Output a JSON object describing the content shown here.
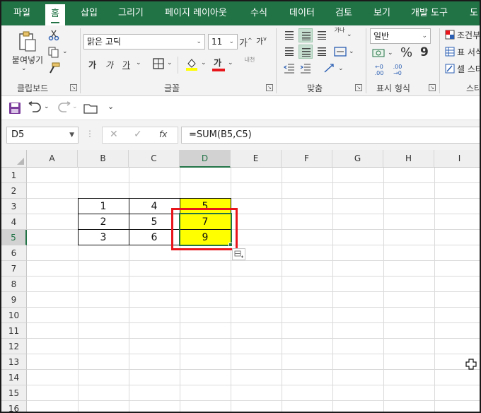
{
  "tabs": [
    "파일",
    "홈",
    "삽입",
    "그리기",
    "페이지 레이아웃",
    "수식",
    "데이터",
    "검토",
    "보기",
    "개발 도구",
    "도"
  ],
  "ribbon": {
    "clipboard": {
      "paste_label": "붙여넣기",
      "group_label": "클립보드"
    },
    "font": {
      "name": "맑은 고딕",
      "size": "11",
      "group_label": "글꼴",
      "bold": "가",
      "italic": "가",
      "underline": "가",
      "grow": "가",
      "shrink": "가",
      "fontcolor_glyph": "가",
      "phonetic": "내천"
    },
    "alignment": {
      "group_label": "맞춤",
      "wrap": "가나"
    },
    "number": {
      "format": "일반",
      "group_label": "표시 형식",
      "percent": "%",
      "comma": "9",
      "inc_dec": "←0 .00",
      "dec_dec": ".00 →0"
    },
    "styles": {
      "cond": "조건부",
      "table": "표 서식",
      "cell": "셀 스타",
      "group_label": "스타"
    }
  },
  "formula_bar": {
    "name_box": "D5",
    "fx": "fx",
    "formula": "=SUM(B5,C5)"
  },
  "grid": {
    "columns": [
      "A",
      "B",
      "C",
      "D",
      "E",
      "F",
      "G",
      "H",
      "I"
    ],
    "selected_column": "D",
    "rows": [
      "1",
      "2",
      "3",
      "4",
      "5",
      "6",
      "7",
      "8",
      "9",
      "10",
      "11",
      "12",
      "13",
      "14",
      "15",
      "16"
    ],
    "selected_row": "5",
    "data_rows": [
      {
        "b": "1",
        "c": "4",
        "d": "5"
      },
      {
        "b": "2",
        "c": "5",
        "d": "7"
      },
      {
        "b": "3",
        "c": "6",
        "d": "9"
      }
    ]
  },
  "colors": {
    "accent": "#217346",
    "highlight": "#ffff00",
    "annotation": "#e8161b"
  }
}
